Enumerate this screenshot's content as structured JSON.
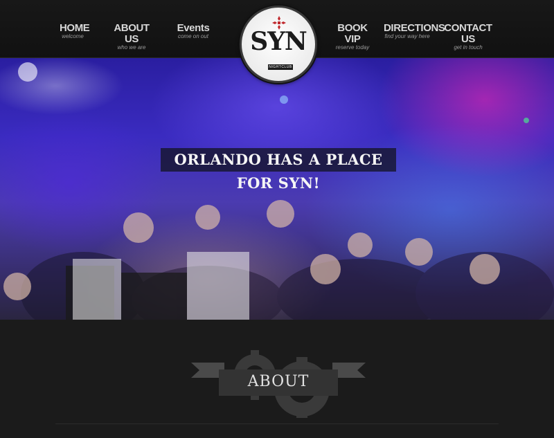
{
  "nav": {
    "left": [
      {
        "title": "HOME",
        "sub": "welcome"
      },
      {
        "title": "ABOUT US",
        "sub": "who we are"
      },
      {
        "title": "Events",
        "sub": "come on out"
      }
    ],
    "right": [
      {
        "title": "BOOK VIP",
        "sub": "reserve today"
      },
      {
        "title": "DIRECTIONS",
        "sub": "find your way here"
      },
      {
        "title": "CONTACT US",
        "sub": "get in touch"
      }
    ]
  },
  "logo": {
    "name": "SYN",
    "tagline": "NIGHTCLUB",
    "icon": "red-cross-icon",
    "accent_color": "#c0282d"
  },
  "hero": {
    "banner_text": "ORLANDO HAS A PLACE FOR SYN!"
  },
  "about": {
    "heading": "ABOUT",
    "icon": "gear-icon"
  },
  "colors": {
    "header_bg": "#151515",
    "nav_text": "#d8d8d8",
    "page_bg": "#1b1b1b"
  }
}
